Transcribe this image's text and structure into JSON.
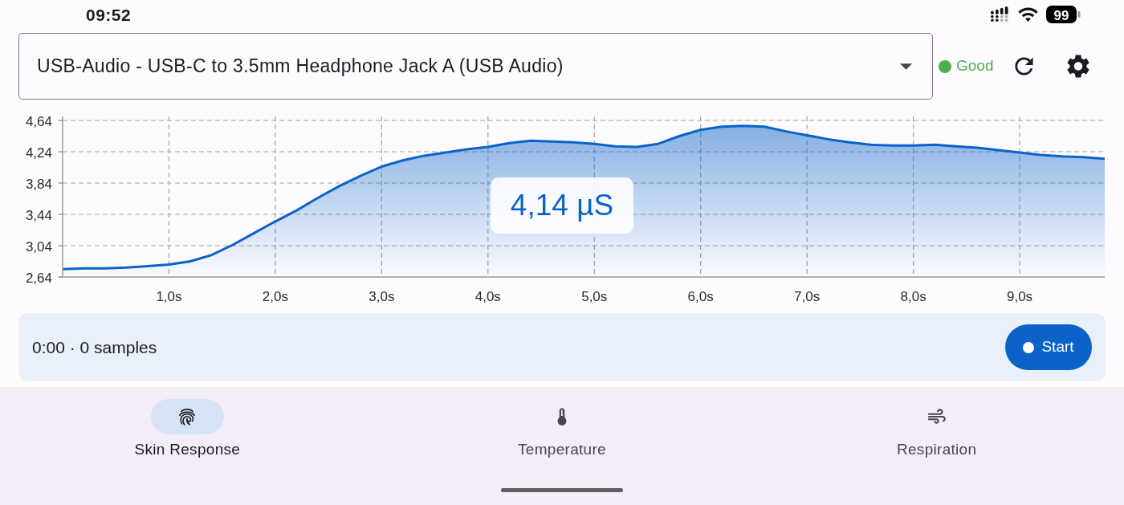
{
  "status_bar": {
    "time": "09:52",
    "battery": "99"
  },
  "device_select": {
    "value": "USB-Audio - USB-C to 3.5mm Headphone Jack A (USB Audio)"
  },
  "signal_quality": {
    "label": "Good",
    "color": "#4caf50"
  },
  "chart": {
    "reading": "4,14 µS",
    "chart_data": {
      "type": "area",
      "grid": true,
      "x": [
        0,
        0.2,
        0.4,
        0.6,
        0.8,
        1.0,
        1.2,
        1.4,
        1.6,
        1.8,
        2.0,
        2.2,
        2.4,
        2.6,
        2.8,
        3.0,
        3.2,
        3.4,
        3.6,
        3.8,
        4.0,
        4.2,
        4.4,
        4.6,
        4.8,
        5.0,
        5.2,
        5.4,
        5.6,
        5.8,
        6.0,
        6.2,
        6.4,
        6.6,
        6.8,
        7.0,
        7.2,
        7.4,
        7.6,
        7.8,
        8.0,
        8.2,
        8.4,
        8.6,
        8.8,
        9.0,
        9.2,
        9.4,
        9.6,
        9.8
      ],
      "series": [
        {
          "color": "#0b63c9",
          "values": [
            2.74,
            2.75,
            2.75,
            2.76,
            2.78,
            2.8,
            2.84,
            2.92,
            3.05,
            3.2,
            3.35,
            3.49,
            3.65,
            3.8,
            3.93,
            4.05,
            4.13,
            4.19,
            4.23,
            4.27,
            4.3,
            4.35,
            4.38,
            4.37,
            4.36,
            4.34,
            4.31,
            4.3,
            4.34,
            4.44,
            4.52,
            4.56,
            4.57,
            4.56,
            4.5,
            4.45,
            4.4,
            4.36,
            4.33,
            4.32,
            4.32,
            4.33,
            4.31,
            4.29,
            4.26,
            4.23,
            4.2,
            4.18,
            4.17,
            4.15
          ]
        }
      ],
      "xlim": [
        0,
        9.8
      ],
      "ylim": [
        2.64,
        4.64
      ],
      "xticks": [
        {
          "value": 1,
          "label": "1,0s"
        },
        {
          "value": 2,
          "label": "2,0s"
        },
        {
          "value": 3,
          "label": "3,0s"
        },
        {
          "value": 4,
          "label": "4,0s"
        },
        {
          "value": 5,
          "label": "5,0s"
        },
        {
          "value": 6,
          "label": "6,0s"
        },
        {
          "value": 7,
          "label": "7,0s"
        },
        {
          "value": 8,
          "label": "8,0s"
        },
        {
          "value": 9,
          "label": "9,0s"
        }
      ],
      "yticks": [
        {
          "value": 2.64,
          "label": "2,64"
        },
        {
          "value": 3.04,
          "label": "3,04"
        },
        {
          "value": 3.44,
          "label": "3,44"
        },
        {
          "value": 3.84,
          "label": "3,84"
        },
        {
          "value": 4.24,
          "label": "4,24"
        },
        {
          "value": 4.64,
          "label": "4,64"
        }
      ]
    }
  },
  "recording": {
    "summary": "0:00 · 0 samples",
    "button": "Start"
  },
  "bottom_nav": [
    {
      "label": "Skin Response",
      "kind": "fingerprint",
      "selected": true
    },
    {
      "label": "Temperature",
      "kind": "thermometer",
      "selected": false
    },
    {
      "label": "Respiration",
      "kind": "wind",
      "selected": false
    }
  ]
}
